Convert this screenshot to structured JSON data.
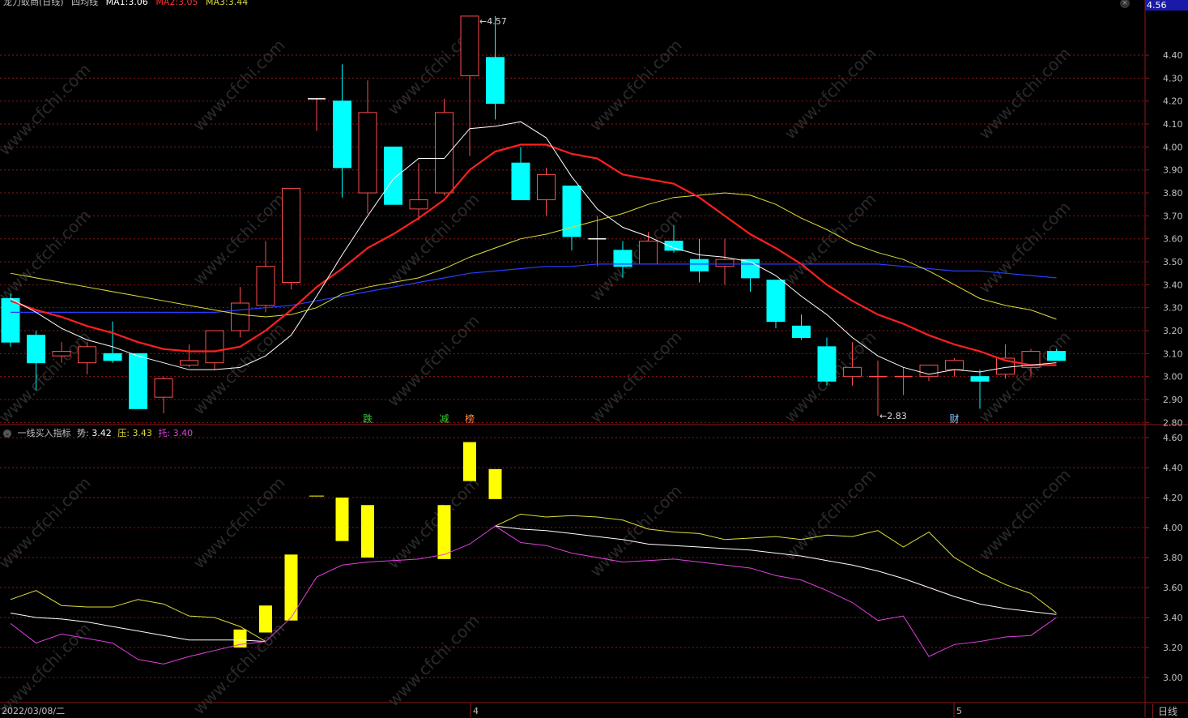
{
  "title_bar": {
    "stock_name": "龙力蚁商(日线)",
    "indicator": "四均线",
    "ma1": "MA1:3.06",
    "ma2": "MA2:3.05",
    "ma3": "MA3:3.44"
  },
  "price_badge": "4.56",
  "price_axis_ticks": [
    "4.40",
    "4.30",
    "4.20",
    "4.10",
    "4.00",
    "3.90",
    "3.80",
    "3.70",
    "3.60",
    "3.50",
    "3.40",
    "3.30",
    "3.20",
    "3.10",
    "3.00",
    "2.90",
    "2.80"
  ],
  "indicator_axis_ticks": [
    "4.60",
    "4.40",
    "4.20",
    "4.00",
    "3.80",
    "3.60",
    "3.40",
    "3.20",
    "3.00"
  ],
  "annotations": {
    "high": "4.57",
    "low": "2.83"
  },
  "event_markers": [
    {
      "label": "跌",
      "color": "#33cc33"
    },
    {
      "label": "减",
      "color": "#33cc33"
    },
    {
      "label": "榜",
      "color": "#ff8844"
    },
    {
      "label": "财",
      "color": "#88ccff"
    }
  ],
  "indicator": {
    "name": "一线买入指标",
    "shi_label": "势:",
    "shi_value": "3.42",
    "ya_label": "压:",
    "ya_value": "3.43",
    "tuo_label": "托:",
    "tuo_value": "3.40"
  },
  "date": "2022/03/08/二",
  "month_labels": [
    "4",
    "5"
  ],
  "period_tab": "日线",
  "colors": {
    "up": "#ff4d4d",
    "down": "#00ffff",
    "ma_white": "#ffffff",
    "ma_red": "#ff2020",
    "ma_yellow": "#dede3a",
    "ma_blue": "#2a3cff",
    "bar_yellow": "#ffff00",
    "tuo": "#e040e0",
    "grid": "#8b1a1a",
    "axis_text": "#c0c0c0"
  },
  "watermark": "www.cfchi.com",
  "chart_data": {
    "type": "candlestick",
    "candles": [
      {
        "o": 3.34,
        "h": 3.36,
        "l": 3.13,
        "c": 3.15
      },
      {
        "o": 3.18,
        "h": 3.2,
        "l": 2.94,
        "c": 3.06
      },
      {
        "o": 3.09,
        "h": 3.15,
        "l": 3.06,
        "c": 3.11
      },
      {
        "o": 3.06,
        "h": 3.15,
        "l": 3.01,
        "c": 3.13
      },
      {
        "o": 3.1,
        "h": 3.24,
        "l": 3.06,
        "c": 3.07
      },
      {
        "o": 3.1,
        "h": 3.1,
        "l": 2.86,
        "c": 2.86
      },
      {
        "o": 2.91,
        "h": 3.0,
        "l": 2.84,
        "c": 2.99
      },
      {
        "o": 3.05,
        "h": 3.14,
        "l": 3.04,
        "c": 3.07
      },
      {
        "o": 3.06,
        "h": 3.2,
        "l": 3.03,
        "c": 3.2
      },
      {
        "o": 3.2,
        "h": 3.39,
        "l": 3.17,
        "c": 3.32
      },
      {
        "o": 3.31,
        "h": 3.59,
        "l": 3.28,
        "c": 3.48
      },
      {
        "o": 3.41,
        "h": 3.82,
        "l": 3.38,
        "c": 3.82
      },
      {
        "o": 4.21,
        "h": 4.21,
        "l": 4.07,
        "c": 4.21
      },
      {
        "o": 4.2,
        "h": 4.36,
        "l": 3.78,
        "c": 3.91
      },
      {
        "o": 3.8,
        "h": 4.29,
        "l": 3.71,
        "c": 4.15
      },
      {
        "o": 4.0,
        "h": 4.0,
        "l": 3.75,
        "c": 3.75
      },
      {
        "o": 3.73,
        "h": 3.93,
        "l": 3.68,
        "c": 3.77
      },
      {
        "o": 3.8,
        "h": 4.21,
        "l": 3.79,
        "c": 4.15
      },
      {
        "o": 4.31,
        "h": 4.57,
        "l": 3.96,
        "c": 4.57
      },
      {
        "o": 4.39,
        "h": 4.57,
        "l": 4.12,
        "c": 4.19
      },
      {
        "o": 3.93,
        "h": 4.0,
        "l": 3.77,
        "c": 3.77
      },
      {
        "o": 3.77,
        "h": 3.91,
        "l": 3.7,
        "c": 3.88
      },
      {
        "o": 3.83,
        "h": 3.83,
        "l": 3.55,
        "c": 3.61
      },
      {
        "o": 3.6,
        "h": 3.7,
        "l": 3.48,
        "c": 3.6
      },
      {
        "o": 3.55,
        "h": 3.59,
        "l": 3.43,
        "c": 3.48
      },
      {
        "o": 3.49,
        "h": 3.63,
        "l": 3.49,
        "c": 3.59
      },
      {
        "o": 3.59,
        "h": 3.66,
        "l": 3.54,
        "c": 3.55
      },
      {
        "o": 3.51,
        "h": 3.6,
        "l": 3.41,
        "c": 3.46
      },
      {
        "o": 3.48,
        "h": 3.6,
        "l": 3.4,
        "c": 3.51
      },
      {
        "o": 3.51,
        "h": 3.51,
        "l": 3.37,
        "c": 3.43
      },
      {
        "o": 3.42,
        "h": 3.42,
        "l": 3.21,
        "c": 3.24
      },
      {
        "o": 3.22,
        "h": 3.27,
        "l": 3.16,
        "c": 3.17
      },
      {
        "o": 3.13,
        "h": 3.17,
        "l": 2.96,
        "c": 2.98
      },
      {
        "o": 3.0,
        "h": 3.15,
        "l": 2.96,
        "c": 3.04
      },
      {
        "o": 3.0,
        "h": 3.07,
        "l": 2.83,
        "c": 3.0
      },
      {
        "o": 3.0,
        "h": 3.04,
        "l": 2.92,
        "c": 3.0
      },
      {
        "o": 3.0,
        "h": 3.05,
        "l": 2.98,
        "c": 3.05
      },
      {
        "o": 3.03,
        "h": 3.08,
        "l": 3.0,
        "c": 3.07
      },
      {
        "o": 3.0,
        "h": 3.03,
        "l": 2.86,
        "c": 2.98
      },
      {
        "o": 3.01,
        "h": 3.14,
        "l": 2.99,
        "c": 3.08
      },
      {
        "o": 3.04,
        "h": 3.12,
        "l": 3.0,
        "c": 3.11
      },
      {
        "o": 3.11,
        "h": 3.12,
        "l": 3.07,
        "c": 3.07
      }
    ],
    "ma_white": [
      3.34,
      3.28,
      3.21,
      3.16,
      3.13,
      3.09,
      3.06,
      3.03,
      3.03,
      3.04,
      3.09,
      3.18,
      3.35,
      3.53,
      3.7,
      3.86,
      3.95,
      3.95,
      4.08,
      4.09,
      4.11,
      4.04,
      3.87,
      3.73,
      3.65,
      3.61,
      3.56,
      3.53,
      3.52,
      3.5,
      3.44,
      3.35,
      3.27,
      3.17,
      3.09,
      3.04,
      3.01,
      3.03,
      3.02,
      3.04,
      3.05,
      3.06
    ],
    "ma_red": [
      3.33,
      3.29,
      3.26,
      3.22,
      3.19,
      3.15,
      3.12,
      3.11,
      3.11,
      3.13,
      3.2,
      3.29,
      3.39,
      3.47,
      3.56,
      3.62,
      3.69,
      3.77,
      3.9,
      3.98,
      4.01,
      4.01,
      3.97,
      3.95,
      3.88,
      3.86,
      3.84,
      3.78,
      3.7,
      3.62,
      3.56,
      3.49,
      3.4,
      3.33,
      3.27,
      3.23,
      3.18,
      3.14,
      3.11,
      3.07,
      3.05,
      3.05
    ],
    "ma_yellow": [
      3.45,
      3.43,
      3.41,
      3.39,
      3.37,
      3.35,
      3.33,
      3.31,
      3.29,
      3.27,
      3.26,
      3.27,
      3.3,
      3.36,
      3.39,
      3.41,
      3.43,
      3.47,
      3.52,
      3.56,
      3.6,
      3.62,
      3.65,
      3.68,
      3.71,
      3.75,
      3.78,
      3.79,
      3.8,
      3.79,
      3.75,
      3.69,
      3.64,
      3.58,
      3.54,
      3.51,
      3.46,
      3.4,
      3.34,
      3.31,
      3.29,
      3.25
    ],
    "ma_blue": [
      3.28,
      3.28,
      3.28,
      3.28,
      3.28,
      3.28,
      3.28,
      3.28,
      3.28,
      3.29,
      3.3,
      3.31,
      3.33,
      3.35,
      3.37,
      3.39,
      3.41,
      3.43,
      3.45,
      3.46,
      3.47,
      3.48,
      3.48,
      3.49,
      3.49,
      3.49,
      3.49,
      3.49,
      3.49,
      3.49,
      3.49,
      3.49,
      3.49,
      3.49,
      3.49,
      3.48,
      3.47,
      3.46,
      3.46,
      3.45,
      3.44,
      3.43
    ],
    "ind_bars": [
      null,
      null,
      null,
      null,
      null,
      null,
      null,
      null,
      null,
      [
        3.2,
        3.32
      ],
      [
        3.3,
        3.48
      ],
      [
        3.38,
        3.82
      ],
      [
        4.21,
        4.21
      ],
      [
        3.91,
        4.2
      ],
      [
        3.8,
        4.15
      ],
      null,
      null,
      [
        3.79,
        4.15
      ],
      [
        4.31,
        4.57
      ],
      [
        4.19,
        4.39
      ],
      null,
      null,
      null,
      null,
      null,
      null,
      null,
      null,
      null,
      null,
      null,
      null,
      null,
      null,
      null,
      null,
      null,
      null,
      null,
      null,
      null,
      null
    ],
    "ind_ya": [
      3.52,
      3.58,
      3.48,
      3.47,
      3.47,
      3.52,
      3.49,
      3.41,
      3.4,
      3.34,
      3.24,
      null,
      null,
      null,
      null,
      null,
      null,
      null,
      null,
      4.01,
      4.09,
      4.07,
      4.08,
      4.07,
      4.05,
      3.99,
      3.97,
      3.96,
      3.92,
      3.93,
      3.94,
      3.92,
      3.95,
      3.94,
      3.98,
      3.87,
      3.97,
      3.8,
      3.7,
      3.62,
      3.56,
      3.43
    ],
    "ind_shi": [
      3.43,
      3.4,
      3.39,
      3.37,
      3.34,
      3.31,
      3.28,
      3.25,
      3.25,
      3.25,
      3.24,
      null,
      null,
      null,
      null,
      null,
      null,
      null,
      null,
      4.01,
      3.99,
      3.98,
      3.96,
      3.94,
      3.92,
      3.89,
      3.88,
      3.87,
      3.86,
      3.85,
      3.83,
      3.81,
      3.78,
      3.75,
      3.71,
      3.66,
      3.6,
      3.54,
      3.49,
      3.46,
      3.44,
      3.42
    ],
    "ind_tuo": [
      3.36,
      3.23,
      3.29,
      3.26,
      3.23,
      3.12,
      3.09,
      3.14,
      3.18,
      3.22,
      3.24,
      3.4,
      3.67,
      3.75,
      3.77,
      3.78,
      3.79,
      3.82,
      3.89,
      4.01,
      3.9,
      3.88,
      3.83,
      3.8,
      3.77,
      3.78,
      3.79,
      3.77,
      3.75,
      3.73,
      3.68,
      3.65,
      3.58,
      3.5,
      3.38,
      3.41,
      3.14,
      3.22,
      3.24,
      3.27,
      3.28,
      3.4
    ]
  }
}
